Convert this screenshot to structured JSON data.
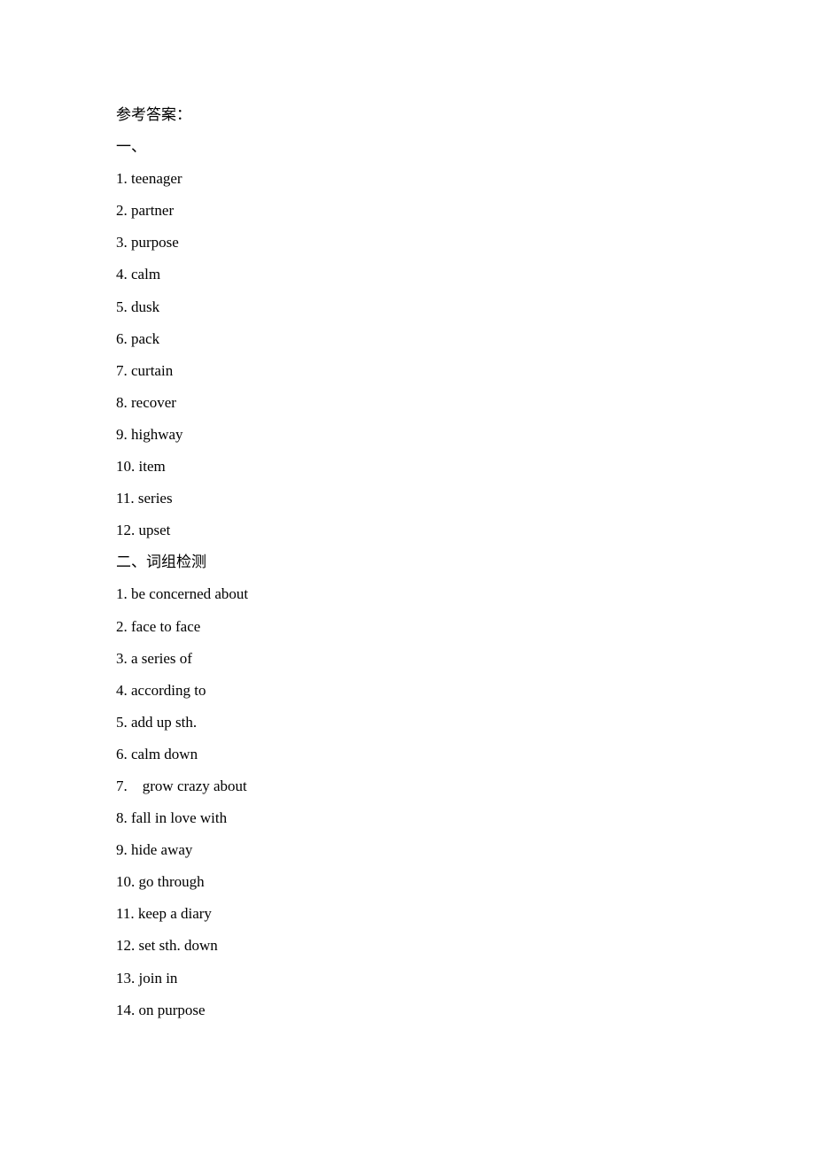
{
  "title": "参考答案：",
  "section1": {
    "heading": "一、",
    "items": [
      "1. teenager",
      "2. partner",
      "3. purpose",
      "4. calm",
      "5. dusk",
      "6. pack",
      "7. curtain",
      "8. recover",
      "9. highway",
      "10. item",
      "11. series",
      "12. upset"
    ]
  },
  "section2": {
    "heading": "二、词组检测",
    "items": [
      "1. be concerned about",
      "2. face to face",
      "3. a series of",
      "4. according to",
      "5. add up sth.",
      "6. calm down",
      "7.    grow crazy about",
      "8. fall in love with",
      "9. hide away",
      "10. go through",
      "11. keep a diary",
      "12. set sth. down",
      "13. join in",
      "14. on purpose"
    ]
  }
}
